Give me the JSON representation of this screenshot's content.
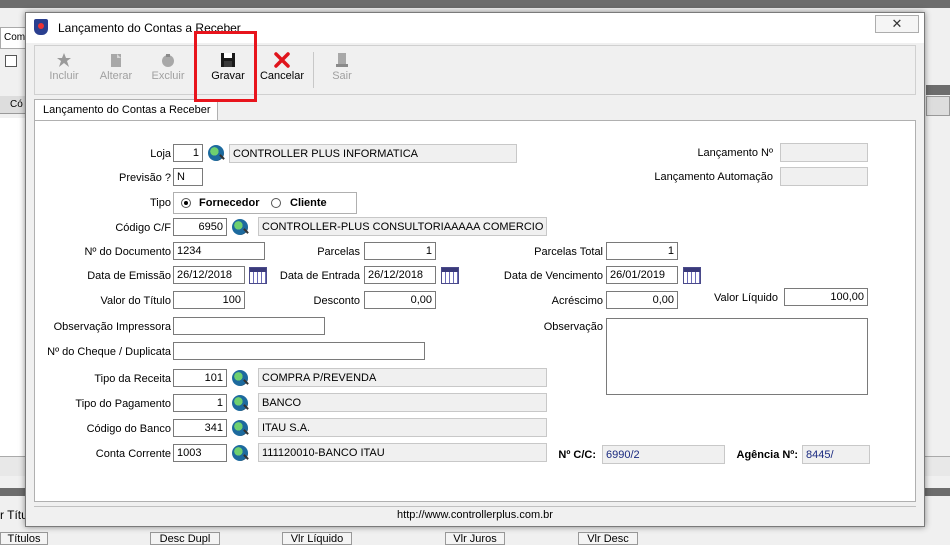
{
  "background": {
    "strip_label": "Com",
    "grid_head_label": "Có",
    "foot_label_left": "r Títulos",
    "columns": [
      "Títulos",
      "Desc Dupl",
      "Vlr Líquido",
      "Vlr Juros",
      "Vlr Desc"
    ]
  },
  "window": {
    "title": "Lançamento do Contas a Receber",
    "close_glyph": "✕"
  },
  "toolbar": {
    "incluir": "Incluir",
    "alterar": "Alterar",
    "excluir": "Excluir",
    "gravar": "Gravar",
    "cancelar": "Cancelar",
    "sair": "Sair"
  },
  "tab": {
    "label": "Lançamento do Contas a Receber"
  },
  "form": {
    "loja": {
      "label": "Loja",
      "code": "1",
      "name": "CONTROLLER PLUS INFORMATICA"
    },
    "previsao": {
      "label": "Previsão ?",
      "value": "N"
    },
    "tipo": {
      "label": "Tipo",
      "option1": "Fornecedor",
      "option2": "Cliente",
      "selected": "Fornecedor"
    },
    "codigo_cf": {
      "label": "Código C/F",
      "code": "6950",
      "name": "CONTROLLER-PLUS CONSULTORIAAAAA COMERCIO TESTE"
    },
    "numero_documento": {
      "label": "Nº do Documento",
      "value": "1234"
    },
    "parcelas": {
      "label": "Parcelas",
      "value": "1"
    },
    "parcelas_total": {
      "label": "Parcelas Total",
      "value": "1"
    },
    "data_emissao": {
      "label": "Data de Emissão",
      "value": "26/12/2018"
    },
    "data_entrada": {
      "label": "Data de Entrada",
      "value": "26/12/2018"
    },
    "data_vencimento": {
      "label": "Data de Vencimento",
      "value": "26/01/2019"
    },
    "valor_titulo": {
      "label": "Valor do Título",
      "value": "100"
    },
    "desconto": {
      "label": "Desconto",
      "value": "0,00"
    },
    "acrescimo": {
      "label": "Acréscimo",
      "value": "0,00"
    },
    "valor_liquido": {
      "label": "Valor Líquido",
      "value": "100,00"
    },
    "observacao_impressora": {
      "label": "Observação Impressora",
      "value": ""
    },
    "observacao": {
      "label": "Observação",
      "value": ""
    },
    "numero_cheque": {
      "label": "Nº do Cheque / Duplicata",
      "value": ""
    },
    "tipo_receita": {
      "label": "Tipo da Receita",
      "code": "101",
      "name": "COMPRA P/REVENDA"
    },
    "tipo_pagamento": {
      "label": "Tipo do Pagamento",
      "code": "1",
      "name": "BANCO"
    },
    "codigo_banco": {
      "label": "Código do Banco",
      "code": "341",
      "name": "ITAU S.A."
    },
    "conta_corrente": {
      "label": "Conta Corrente",
      "code": "1003",
      "name": "111120010-BANCO ITAU"
    },
    "numero_cc": {
      "label": "Nº C/C:",
      "value": "6990/2"
    },
    "agencia": {
      "label": "Agência Nº:",
      "value": "8445/"
    },
    "lancamento_numero": {
      "label": "Lançamento Nº",
      "value": ""
    },
    "lancamento_automacao": {
      "label": "Lançamento Automação",
      "value": ""
    }
  },
  "footer": {
    "url": "http://www.controllerplus.com.br"
  },
  "colors": {
    "highlight": "#e8141c",
    "ro_text": "#1a2a80"
  }
}
